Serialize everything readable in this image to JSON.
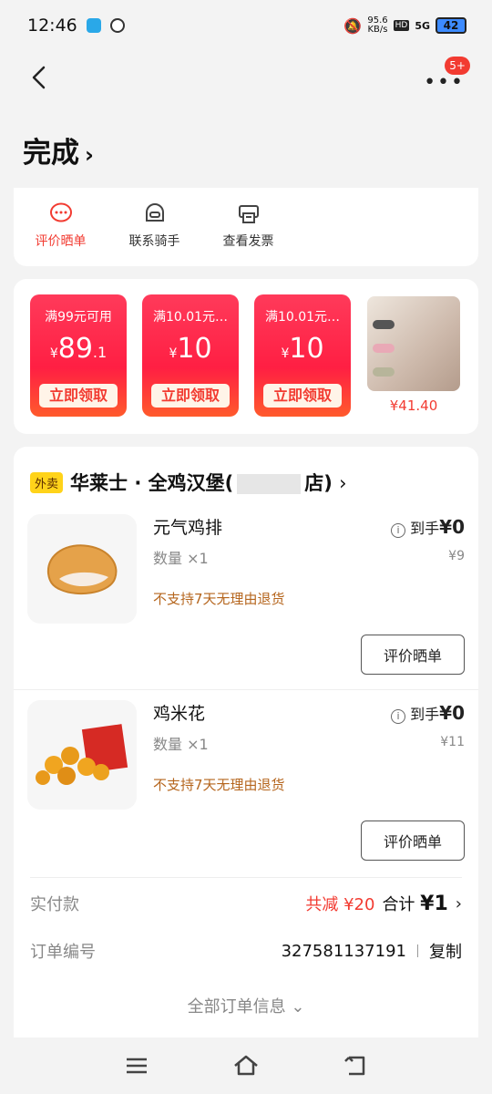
{
  "status": {
    "time": "12:46",
    "net_speed": "95.6",
    "net_unit": "KB/s",
    "hd": "HD",
    "signal": "5G",
    "battery": "42"
  },
  "topbar": {
    "badge": "5+"
  },
  "header": {
    "title": "完成",
    "arrow": "›"
  },
  "actions": [
    {
      "label": "评价晒单",
      "active": true
    },
    {
      "label": "联系骑手",
      "active": false
    },
    {
      "label": "查看发票",
      "active": false
    }
  ],
  "coupons": [
    {
      "cond": "满99元可用",
      "cur": "¥",
      "num": "89",
      "dec": ".1",
      "btn": "立即领取"
    },
    {
      "cond": "满10.01元…",
      "cur": "¥",
      "num": "10",
      "dec": "",
      "btn": "立即领取"
    },
    {
      "cond": "满10.01元…",
      "cur": "¥",
      "num": "10",
      "dec": "",
      "btn": "立即领取"
    }
  ],
  "product": {
    "price": "¥41.40"
  },
  "order": {
    "tag": "外卖",
    "store_prefix": "华莱士 · 全鸡汉堡(",
    "store_suffix": "店)",
    "store_arrow": "›",
    "items": [
      {
        "name": "元气鸡排",
        "qty": "数量 ×1",
        "note": "不支持7天无理由退货",
        "info_prefix": "到手",
        "info_value": "¥0",
        "orig": "¥9",
        "review": "评价晒单"
      },
      {
        "name": "鸡米花",
        "qty": "数量 ×1",
        "note": "不支持7天无理由退货",
        "info_prefix": "到手",
        "info_value": "¥0",
        "orig": "¥11",
        "review": "评价晒单"
      }
    ],
    "paid_label": "实付款",
    "reduce": "共减 ¥20",
    "total_label": "合计",
    "total_value": "¥1",
    "order_no_label": "订单编号",
    "order_no": "327581137191",
    "copy": "复制",
    "all_info": "全部订单信息 ⌄"
  },
  "colors": {
    "accent": "#f23b31",
    "tag": "#ffd31a",
    "note": "#b5651d"
  }
}
